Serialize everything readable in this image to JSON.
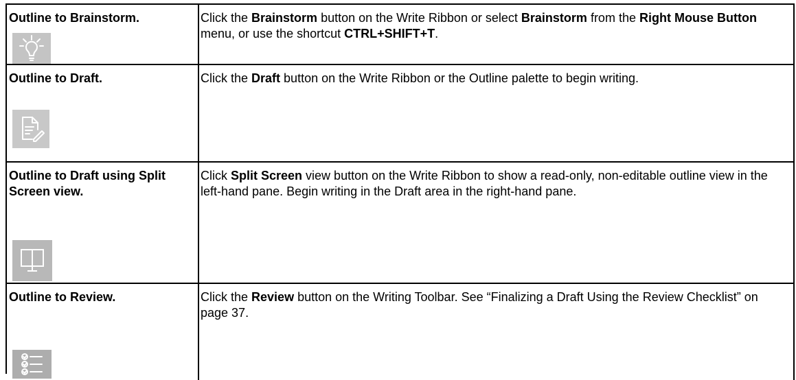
{
  "rows": [
    {
      "heading": "Outline to Brainstorm.",
      "icon": "lightbulb-icon",
      "desc": [
        {
          "t": " Click the ",
          "b": false
        },
        {
          "t": "Brainstorm",
          "b": true
        },
        {
          "t": " button on the Write Ribbon or select ",
          "b": false
        },
        {
          "t": "Brainstorm",
          "b": true
        },
        {
          "t": " from the ",
          "b": false
        },
        {
          "t": "Right Mouse Button",
          "b": true
        },
        {
          "t": " menu, or use the shortcut ",
          "b": false
        },
        {
          "t": "CTRL+SHIFT+T",
          "b": true
        },
        {
          "t": ".",
          "b": false
        }
      ]
    },
    {
      "heading": "Outline to Draft.",
      "icon": "document-pencil-icon",
      "desc": [
        {
          "t": "Click the ",
          "b": false
        },
        {
          "t": "Draft",
          "b": true
        },
        {
          "t": " button on the Write Ribbon or the Outline palette to begin writing.",
          "b": false
        }
      ]
    },
    {
      "heading": "Outline to Draft using Split Screen view.",
      "icon": "split-screen-monitor-icon",
      "desc": [
        {
          "t": "Click ",
          "b": false
        },
        {
          "t": "Split Screen",
          "b": true
        },
        {
          "t": " view button on the Write Ribbon to show a read-only, non-editable outline view in the left-hand pane. Begin writing in the Draft area in the right-hand pane.",
          "b": false
        }
      ]
    },
    {
      "heading": "Outline to Review.",
      "icon": "checklist-icon",
      "desc": [
        {
          "t": "Click the ",
          "b": false
        },
        {
          "t": "Review",
          "b": true
        },
        {
          "t": " button on the Writing Toolbar. See “Finalizing a Draft Using the Review Checklist” on page 37.",
          "b": false
        }
      ]
    }
  ]
}
